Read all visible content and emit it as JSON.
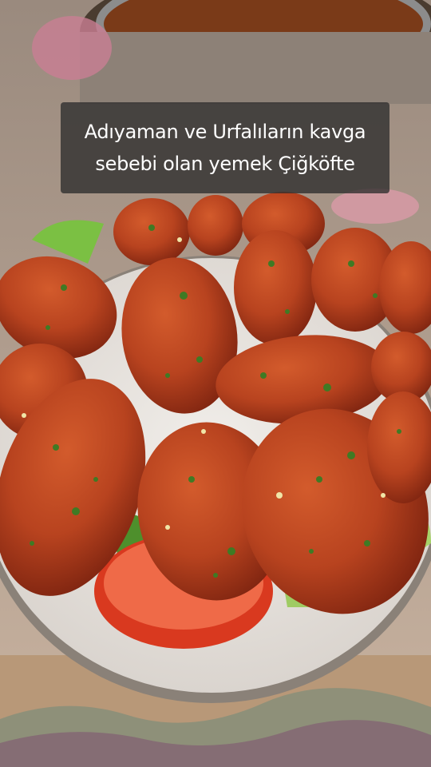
{
  "caption": {
    "line1": "Adıyaman ve Urfalıların kavga",
    "line2": "sebebi olan yemek Çiğköfte"
  },
  "scene": {
    "subject": "çiğköfte",
    "colors": {
      "kofte": "#b8431f",
      "kofte_dark": "#7e2410",
      "plate": "#e9e6e3",
      "plate_rim": "#8a8178",
      "lettuce": "#6fae38",
      "tomato": "#e0442a",
      "table": "#c9a886",
      "pot": "#5a4a3c"
    }
  }
}
